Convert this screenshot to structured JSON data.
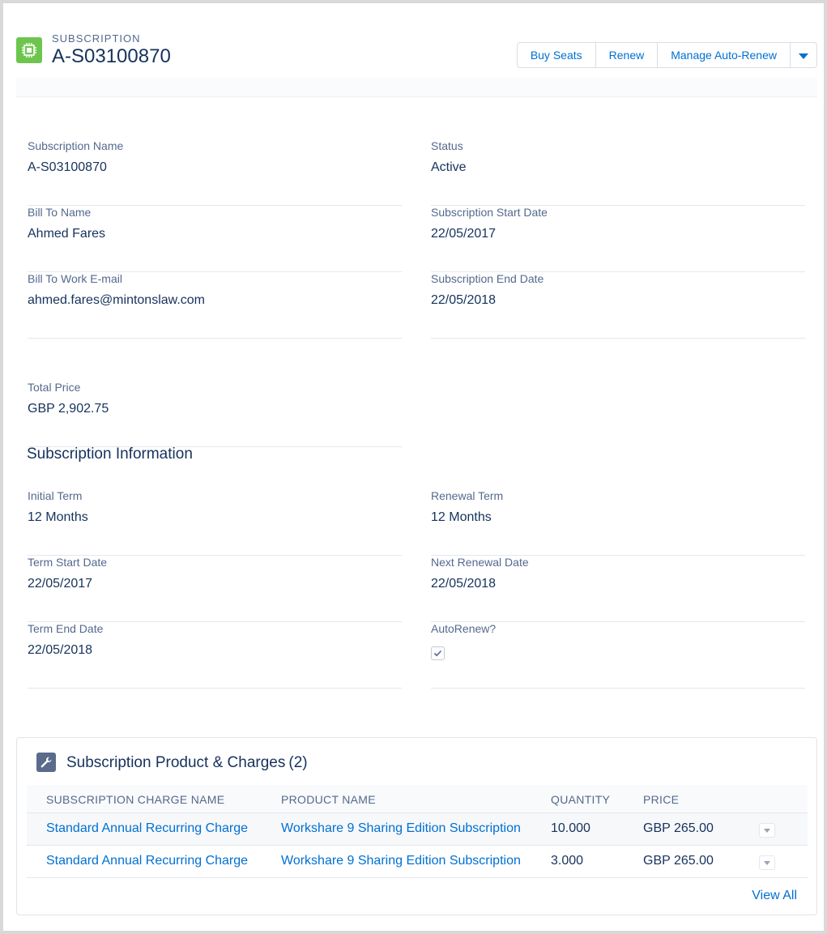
{
  "header": {
    "object_type": "SUBSCRIPTION",
    "title": "A-S03100870",
    "icon": "subscription-chip-icon",
    "actions": [
      "Buy Seats",
      "Renew",
      "Manage Auto-Renew"
    ],
    "more_icon": "chevron-down-icon"
  },
  "fields": {
    "subscription_name": {
      "label": "Subscription Name",
      "value": "A-S03100870"
    },
    "status": {
      "label": "Status",
      "value": "Active"
    },
    "bill_to_name": {
      "label": "Bill To Name",
      "value": "Ahmed Fares"
    },
    "start_date": {
      "label": "Subscription Start Date",
      "value": "22/05/2017"
    },
    "bill_to_email": {
      "label": "Bill To Work E-mail",
      "value": "ahmed.fares@mintonslaw.com"
    },
    "end_date": {
      "label": "Subscription End Date",
      "value": "22/05/2018"
    },
    "total_price": {
      "label": "Total Price",
      "value": "GBP 2,902.75"
    }
  },
  "subscription_info": {
    "title": "Subscription Information",
    "initial_term": {
      "label": "Initial Term",
      "value": "12 Months"
    },
    "renewal_term": {
      "label": "Renewal Term",
      "value": "12 Months"
    },
    "term_start": {
      "label": "Term Start Date",
      "value": "22/05/2017"
    },
    "next_renewal": {
      "label": "Next Renewal Date",
      "value": "22/05/2018"
    },
    "term_end": {
      "label": "Term End Date",
      "value": "22/05/2018"
    },
    "auto_renew": {
      "label": "AutoRenew?",
      "checked": true
    }
  },
  "related": {
    "title": "Subscription Product & Charges",
    "count": "(2)",
    "icon": "wrench-icon",
    "columns": [
      "SUBSCRIPTION CHARGE NAME",
      "PRODUCT NAME",
      "QUANTITY",
      "PRICE"
    ],
    "rows": [
      {
        "charge": "Standard Annual Recurring Charge",
        "product": "Workshare 9 Sharing Edition Subscription",
        "quantity": "10.000",
        "price": "GBP 265.00"
      },
      {
        "charge": "Standard Annual Recurring Charge",
        "product": "Workshare 9 Sharing Edition Subscription",
        "quantity": "3.000",
        "price": "GBP 265.00"
      }
    ],
    "view_all": "View All"
  }
}
